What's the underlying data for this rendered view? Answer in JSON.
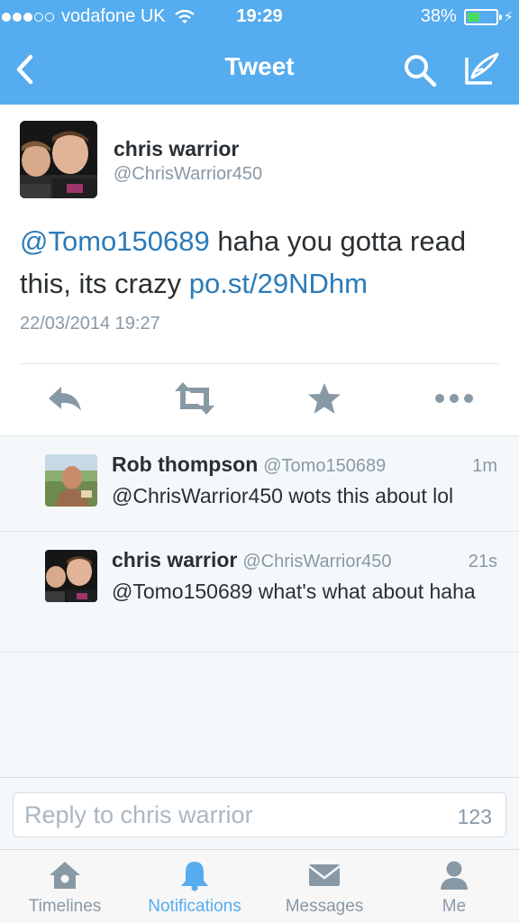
{
  "status_bar": {
    "signal_full": 3,
    "signal_empty": 2,
    "carrier": "vodafone UK",
    "time": "19:29",
    "battery": "38%",
    "battery_level": 0.38
  },
  "nav": {
    "title": "Tweet",
    "back_icon": "chevron-left-icon",
    "search_icon": "search-icon",
    "compose_icon": "compose-icon"
  },
  "tweet": {
    "name": "chris warrior",
    "handle": "@ChrisWarrior450",
    "mention": "@Tomo150689",
    "text": " haha you gotta read this, its crazy ",
    "link": "po.st/29NDhm",
    "timestamp": "22/03/2014 19:27",
    "actions": [
      "reply-icon",
      "retweet-icon",
      "favorite-icon",
      "more-icon"
    ]
  },
  "replies": [
    {
      "name": "Rob thompson",
      "handle": "@Tomo150689",
      "time": "1m",
      "text": "@ChrisWarrior450 wots this about lol"
    },
    {
      "name": "chris warrior",
      "handle": "@ChrisWarrior450",
      "time": "21s",
      "text": "@Tomo150689 what's what about haha"
    }
  ],
  "reply_bar": {
    "placeholder": "Reply to chris warrior",
    "char_count": "123"
  },
  "tabs": [
    {
      "label": "Timelines",
      "icon": "home-icon",
      "active": false
    },
    {
      "label": "Notifications",
      "icon": "bell-icon",
      "active": true
    },
    {
      "label": "Messages",
      "icon": "envelope-icon",
      "active": false
    },
    {
      "label": "Me",
      "icon": "person-icon",
      "active": false
    }
  ],
  "colors": {
    "brand": "#55acee",
    "link": "#2b7bb9",
    "muted": "#8899a6",
    "battery_fill": "#4cd964"
  }
}
